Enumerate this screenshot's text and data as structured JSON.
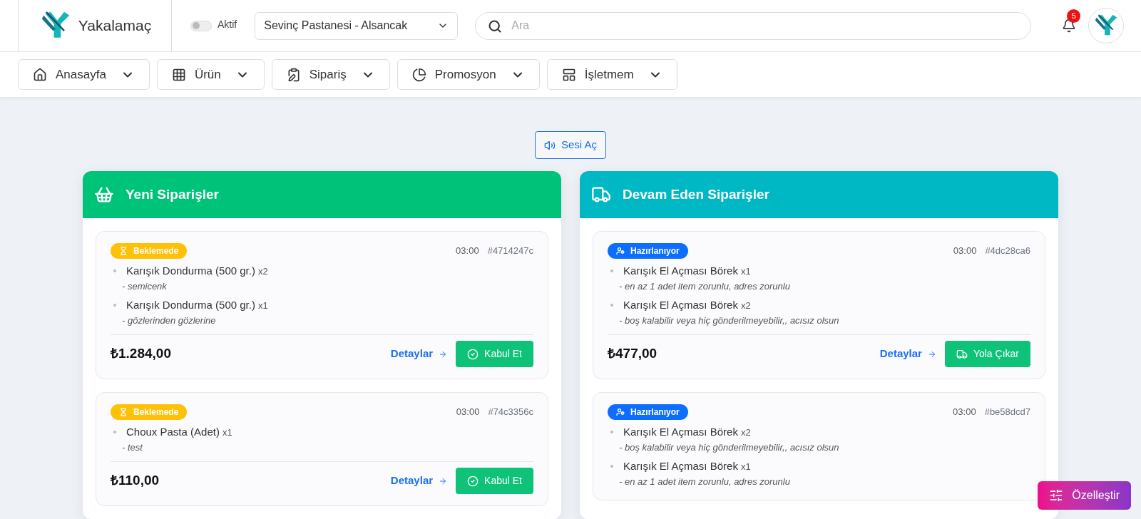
{
  "header": {
    "brand": "Yakalamaç",
    "active_toggle": {
      "label": "Aktif",
      "on": false
    },
    "branch_select": {
      "value": "Sevinç Pastanesi - Alsancak"
    },
    "search": {
      "placeholder": "Ara"
    },
    "notification_count": "5"
  },
  "nav": [
    {
      "label": "Anasayfa",
      "kind": "home"
    },
    {
      "label": "Ürün",
      "kind": "grid"
    },
    {
      "label": "Sipariş",
      "kind": "clipboard"
    },
    {
      "label": "Promosyon",
      "kind": "pie"
    },
    {
      "label": "İşletmem",
      "kind": "layout"
    }
  ],
  "sound_button": "Sesi Aç",
  "columns": [
    {
      "title": "Yeni Siparişler",
      "kind": "new",
      "orders": [
        {
          "status": {
            "label": "Beklemede",
            "kind": "waiting"
          },
          "time": "03:00",
          "id": "#4714247c",
          "items": [
            {
              "name": "Karışık Dondurma (500 gr.)",
              "qty": "x2",
              "note": "- semicenk"
            },
            {
              "name": "Karışık Dondurma (500 gr.)",
              "qty": "x1",
              "note": "- gözlerinden gözlerine"
            }
          ],
          "price": "₺1.284,00",
          "details": "Detaylar",
          "action": {
            "label": "Kabul Et",
            "kind": "accept"
          }
        },
        {
          "status": {
            "label": "Beklemede",
            "kind": "waiting"
          },
          "time": "03:00",
          "id": "#74c3356c",
          "items": [
            {
              "name": "Choux Pasta (Adet)",
              "qty": "x1",
              "note": "- test"
            }
          ],
          "price": "₺110,00",
          "details": "Detaylar",
          "action": {
            "label": "Kabul Et",
            "kind": "accept"
          }
        }
      ]
    },
    {
      "title": "Devam Eden Siparişler",
      "kind": "ongoing",
      "orders": [
        {
          "status": {
            "label": "Hazırlanıyor",
            "kind": "preparing"
          },
          "time": "03:00",
          "id": "#4dc28ca6",
          "items": [
            {
              "name": "Karışık El Açması Börek",
              "qty": "x1",
              "note": "- en az 1 adet item zorunlu, adres zorunlu"
            },
            {
              "name": "Karışık El Açması Börek",
              "qty": "x2",
              "note": "- boş kalabilir veya hiç gönderilmeyebilir,, acısız olsun"
            }
          ],
          "price": "₺477,00",
          "details": "Detaylar",
          "action": {
            "label": "Yola Çıkar",
            "kind": "ship"
          }
        },
        {
          "status": {
            "label": "Hazırlanıyor",
            "kind": "preparing"
          },
          "time": "03:00",
          "id": "#be58dcd7",
          "items": [
            {
              "name": "Karışık El Açması Börek",
              "qty": "x2",
              "note": "- boş kalabilir veya hiç gönderilmeyebilir,, acısız olsun"
            },
            {
              "name": "Karışık El Açması Börek",
              "qty": "x1",
              "note": "- en az 1 adet item zorunlu, adres zorunlu"
            }
          ]
        }
      ]
    }
  ],
  "customize_button": "Özelleştir"
}
